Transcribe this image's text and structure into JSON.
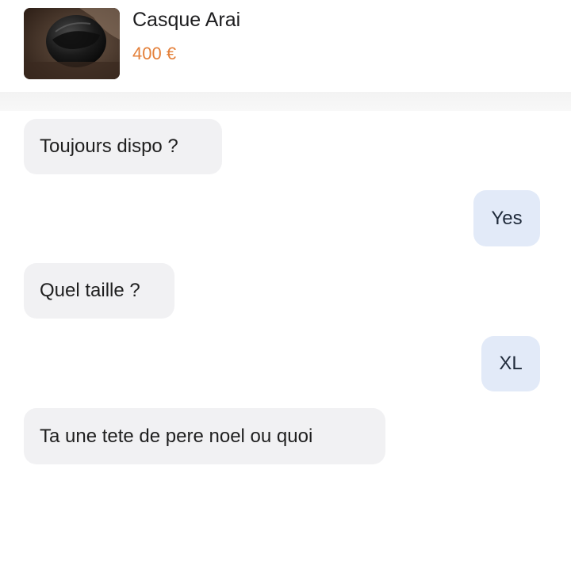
{
  "listing": {
    "title": "Casque Arai",
    "price": "400 €",
    "thumbnail_icon": "helmet-photo"
  },
  "messages": [
    {
      "side": "received",
      "text": "Toujours dispo ?"
    },
    {
      "side": "sent",
      "text": "Yes"
    },
    {
      "side": "received",
      "text": "Quel taille ?"
    },
    {
      "side": "sent",
      "text": "XL"
    },
    {
      "side": "received",
      "text": "Ta une tete de pere noel ou quoi"
    }
  ],
  "colors": {
    "price": "#e4803a",
    "received_bubble": "#f1f1f3",
    "sent_bubble": "#e2eaf8"
  }
}
